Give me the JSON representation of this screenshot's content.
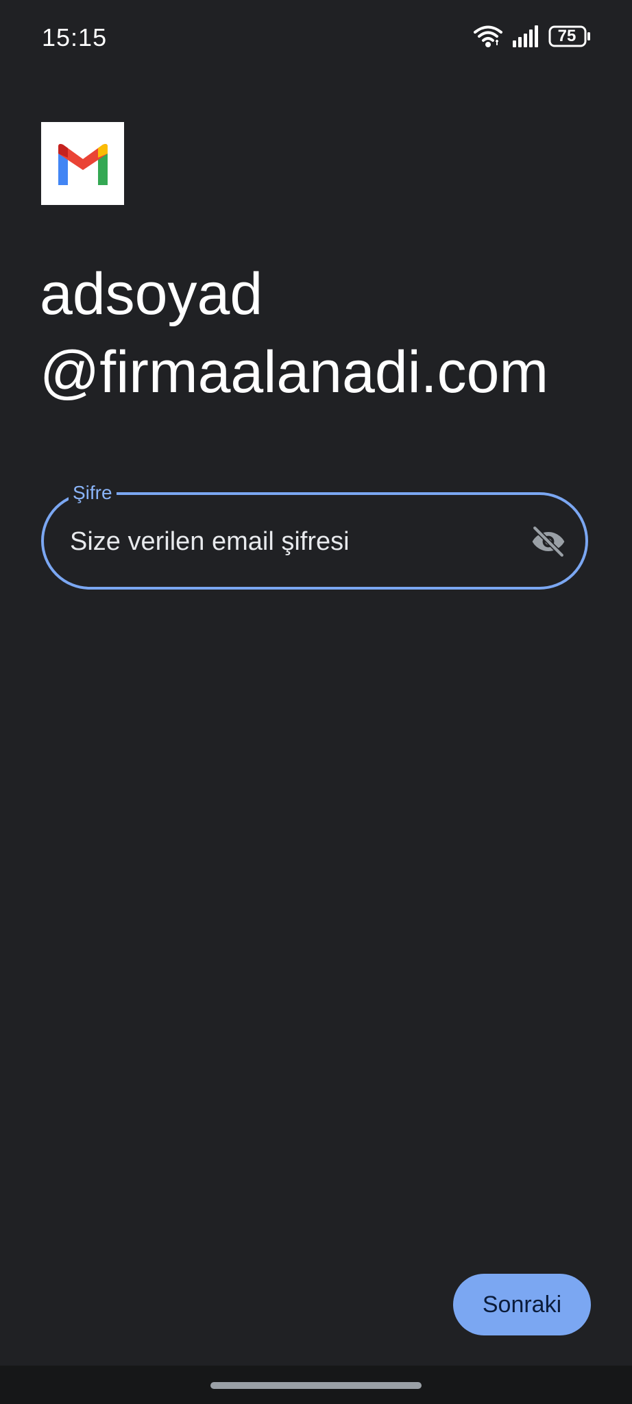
{
  "status_bar": {
    "time": "15:15",
    "battery_level": "75",
    "icons": [
      "wifi-icon",
      "signal-icon",
      "battery-icon"
    ]
  },
  "logo": {
    "icon": "gmail-logo"
  },
  "account": {
    "line1": "adsoyad",
    "line2": "@firmaalanadi.com"
  },
  "password_field": {
    "label": "Şifre",
    "placeholder": "Size verilen email şifresi",
    "value": "",
    "toggle_icon": "visibility-off-icon"
  },
  "actions": {
    "next_label": "Sonraki"
  },
  "colors": {
    "background": "#202124",
    "accent": "#7ba7f2",
    "label": "#8ab4f8",
    "text": "#ffffff"
  }
}
